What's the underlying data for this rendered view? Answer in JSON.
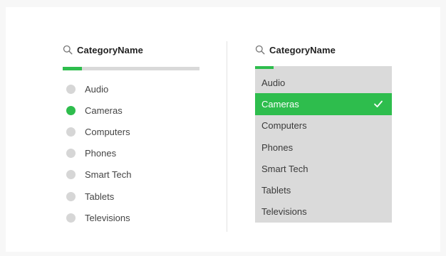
{
  "left": {
    "field_name": "CategoryName",
    "progress": 0.14,
    "options": [
      {
        "label": "Audio",
        "selected": false
      },
      {
        "label": "Cameras",
        "selected": true
      },
      {
        "label": "Computers",
        "selected": false
      },
      {
        "label": "Phones",
        "selected": false
      },
      {
        "label": "Smart Tech",
        "selected": false
      },
      {
        "label": "Tablets",
        "selected": false
      },
      {
        "label": "Televisions",
        "selected": false
      }
    ]
  },
  "right": {
    "field_name": "CategoryName",
    "options": [
      {
        "label": "Audio",
        "selected": false
      },
      {
        "label": "Cameras",
        "selected": true
      },
      {
        "label": "Computers",
        "selected": false
      },
      {
        "label": "Phones",
        "selected": false
      },
      {
        "label": "Smart Tech",
        "selected": false
      },
      {
        "label": "Tablets",
        "selected": false
      },
      {
        "label": "Televisions",
        "selected": false
      }
    ]
  },
  "colors": {
    "accent": "#2ebd4d",
    "track": "#d9d9d9",
    "listbox": "#dadada",
    "dot": "#d6d6d6"
  },
  "icons": {
    "search": "search-icon",
    "check": "check-icon"
  }
}
